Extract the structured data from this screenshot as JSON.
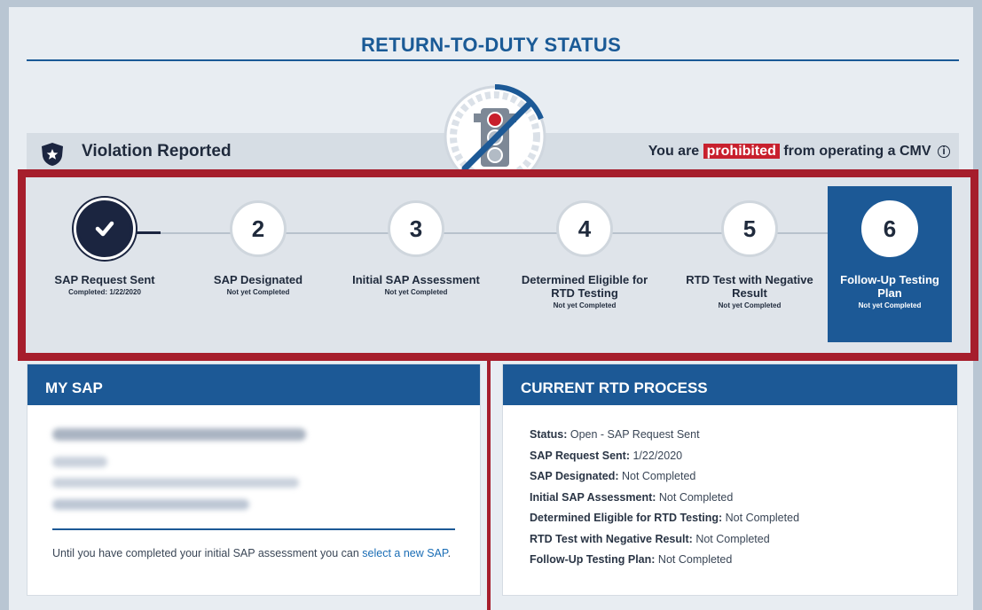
{
  "page": {
    "title": "RETURN-TO-DUTY STATUS"
  },
  "violation": {
    "label": "Violation Reported",
    "prohibited_prefix": "You are",
    "prohibited_word": "prohibited",
    "prohibited_suffix": "from operating a CMV",
    "info_icon": "i"
  },
  "steps": [
    {
      "number": "",
      "name": "SAP Request Sent",
      "sub": "Completed: 1/22/2020",
      "state": "done"
    },
    {
      "number": "2",
      "name": "SAP Designated",
      "sub": "Not yet Completed",
      "state": "pending"
    },
    {
      "number": "3",
      "name": "Initial SAP Assessment",
      "sub": "Not yet Completed",
      "state": "pending"
    },
    {
      "number": "4",
      "name": "Determined Eligible for RTD Testing",
      "sub": "Not yet Completed",
      "state": "pending"
    },
    {
      "number": "5",
      "name": "RTD Test with Negative Result",
      "sub": "Not yet Completed",
      "state": "pending"
    },
    {
      "number": "6",
      "name": "Follow-Up Testing Plan",
      "sub": "Not yet Completed",
      "state": "active"
    }
  ],
  "my_sap": {
    "header": "MY SAP",
    "note_text": "Until you have completed your initial SAP assessment you can ",
    "note_link": "select a new SAP",
    "note_end": "."
  },
  "current_rtd": {
    "header": "CURRENT RTD PROCESS",
    "rows": [
      {
        "key": "Status:",
        "value": "Open - SAP Request Sent"
      },
      {
        "key": "SAP Request Sent:",
        "value": "1/22/2020"
      },
      {
        "key": "SAP Designated:",
        "value": "Not Completed"
      },
      {
        "key": "Initial SAP Assessment:",
        "value": "Not Completed"
      },
      {
        "key": "Determined Eligible for RTD Testing:",
        "value": "Not Completed"
      },
      {
        "key": "RTD Test with Negative Result:",
        "value": "Not Completed"
      },
      {
        "key": "Follow-Up Testing Plan:",
        "value": "Not Completed"
      }
    ]
  },
  "colors": {
    "brand_blue": "#1c5996",
    "alert_red": "#c8202d",
    "frame_red": "#a61e2c",
    "navy": "#1b2540"
  }
}
